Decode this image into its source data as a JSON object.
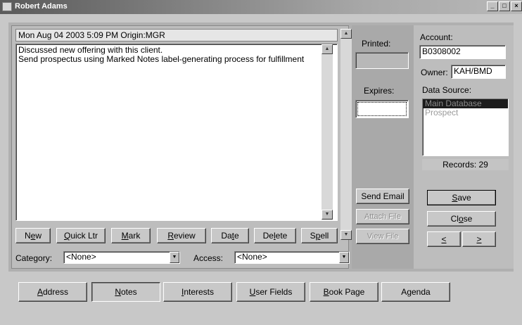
{
  "window": {
    "title": "Robert Adams",
    "controls": [
      "_",
      "□",
      "×"
    ]
  },
  "note": {
    "header": "Mon Aug 04 2003  5:09 PM  Origin:MGR",
    "body": "Discussed new offering with this client.\nSend prospectus using Marked Notes label-generating process for fulfillment"
  },
  "note_buttons": [
    {
      "pre": "N",
      "ul": "e",
      "post": "w"
    },
    {
      "pre": "",
      "ul": "Q",
      "post": "uick Ltr"
    },
    {
      "pre": "",
      "ul": "M",
      "post": "ark"
    },
    {
      "pre": "",
      "ul": "R",
      "post": "eview"
    },
    {
      "pre": "Da",
      "ul": "t",
      "post": "e"
    },
    {
      "pre": "De",
      "ul": "l",
      "post": "ete"
    },
    {
      "pre": "S",
      "ul": "p",
      "post": "ell"
    }
  ],
  "category": {
    "label": "Category:",
    "value": "<None>"
  },
  "access": {
    "label": "Access:",
    "value": "<None>"
  },
  "middle": {
    "printed_label": "Printed:",
    "printed_value": "",
    "expires_label": "Expires:",
    "expires_value": "",
    "send_email": "Send Email",
    "attach_file": "Attach File",
    "view_file": "View File"
  },
  "account": {
    "account_label": "Account:",
    "account_value": "B0308002",
    "owner_label": "Owner:",
    "owner_value": "KAH/BMD",
    "data_source_label": "Data Source:",
    "data_sources": [
      "Main Database",
      "Prospect"
    ],
    "records": "Records: 29"
  },
  "actions": {
    "save": {
      "pre": "",
      "ul": "S",
      "post": "ave"
    },
    "close": {
      "pre": "Cl",
      "ul": "o",
      "post": "se"
    },
    "prev": "<",
    "next": ">"
  },
  "tabs": [
    {
      "pre": "",
      "ul": "A",
      "post": "ddress"
    },
    {
      "pre": "",
      "ul": "N",
      "post": "otes"
    },
    {
      "pre": "",
      "ul": "I",
      "post": "nterests"
    },
    {
      "pre": "",
      "ul": "U",
      "post": "ser Fields"
    },
    {
      "pre": "",
      "ul": "B",
      "post": "ook Page"
    },
    {
      "pre": "A",
      "ul": "g",
      "post": "enda"
    }
  ]
}
